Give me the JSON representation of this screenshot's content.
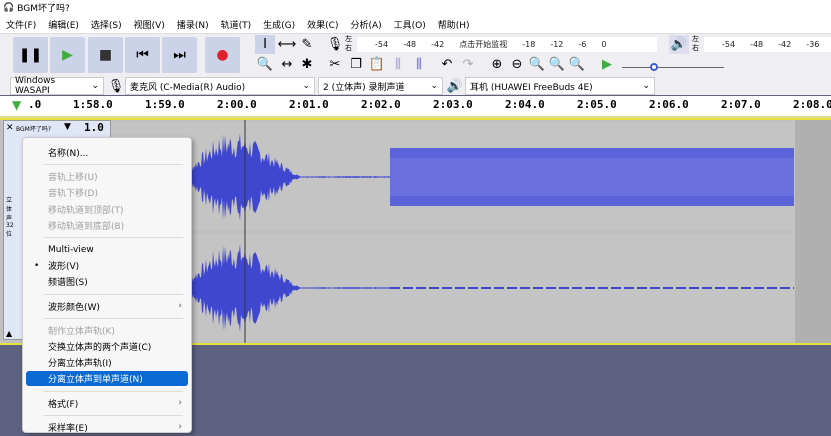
{
  "title": "BGM坏了吗?",
  "menu": [
    "文件(F)",
    "编辑(E)",
    "选择(S)",
    "视图(V)",
    "播录(N)",
    "轨道(T)",
    "生成(G)",
    "效果(C)",
    "分析(A)",
    "工具(O)",
    "帮助(H)"
  ],
  "meter": {
    "lr": "左右",
    "rec_ticks": [
      "-54",
      "-48",
      "-42",
      "点击开始监视",
      "-18",
      "-12",
      "-6",
      "0"
    ],
    "play_ticks": [
      "-54",
      "-48",
      "-42",
      "-36"
    ]
  },
  "devices": {
    "host": "Windows WASAPI",
    "input": "麦克风 (C-Media(R) Audio)",
    "channels": "2 (立体声) 录制声道",
    "output": "耳机 (HUAWEI FreeBuds 4E)"
  },
  "ruler": [
    ".0",
    "1:58.0",
    "1:59.0",
    "2:00.0",
    "2:01.0",
    "2:02.0",
    "2:03.0",
    "2:04.0",
    "2:05.0",
    "2:06.0",
    "2:07.0",
    "2:08.0"
  ],
  "track": {
    "name": "BGM坏了吗?",
    "scale": "1.0",
    "info": "立体声 32位"
  },
  "context_menu": [
    {
      "label": "名称(N)...",
      "state": "normal"
    },
    {
      "sep": true
    },
    {
      "label": "音轨上移(U)",
      "state": "disabled"
    },
    {
      "label": "音轨下移(D)",
      "state": "disabled"
    },
    {
      "label": "移动轨道到顶部(T)",
      "state": "disabled"
    },
    {
      "label": "移动轨道到底部(B)",
      "state": "disabled"
    },
    {
      "sep": true
    },
    {
      "label": "Multi-view",
      "state": "normal"
    },
    {
      "label": "波形(V)",
      "state": "checked"
    },
    {
      "label": "频谱图(S)",
      "state": "normal"
    },
    {
      "sep": true
    },
    {
      "label": "波形颜色(W)",
      "state": "normal",
      "submenu": true
    },
    {
      "sep": true
    },
    {
      "label": "制作立体声轨(K)",
      "state": "disabled"
    },
    {
      "label": "交换立体声的两个声道(C)",
      "state": "normal"
    },
    {
      "label": "分离立体声轨(I)",
      "state": "normal"
    },
    {
      "label": "分离立体声到单声道(N)",
      "state": "highlighted"
    },
    {
      "sep": true
    },
    {
      "label": "格式(F)",
      "state": "normal",
      "submenu": true
    },
    {
      "sep": true
    },
    {
      "label": "采样率(E)",
      "state": "normal",
      "submenu": true
    }
  ],
  "colors": {
    "waveform": "#3f47d0",
    "highlight": "#0a69d2",
    "track_border": "#e6e23c"
  }
}
